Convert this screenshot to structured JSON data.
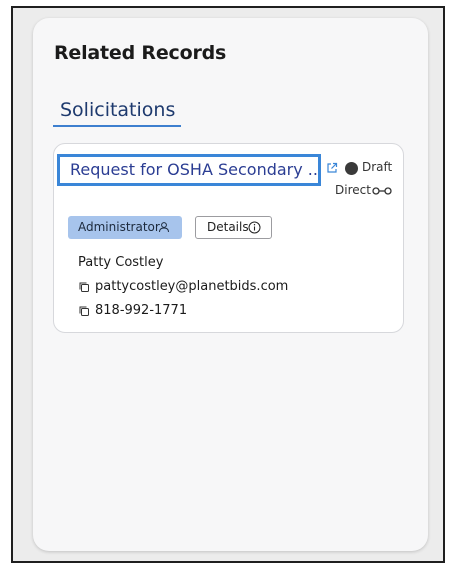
{
  "panel": {
    "title": "Related Records"
  },
  "tabs": [
    {
      "label": "Solicitations",
      "active": true
    }
  ],
  "record": {
    "title": "Request for OSHA Secondary ...",
    "status": "Draft",
    "status_color": "#3a3a3a",
    "link_type": "Direct",
    "role_badge": "Administrator",
    "details_label": "Details",
    "contact": {
      "name": "Patty Costley",
      "email": "pattycostley@planetbids.com",
      "phone": "818-992-1771"
    }
  },
  "colors": {
    "accent": "#3a86d8",
    "title_text": "#2b3d93",
    "badge_bg": "#a7c4ec",
    "tab_text": "#1e3a6e"
  },
  "icons": {
    "external_link": "external-link-icon",
    "link": "link-chain-icon",
    "user": "user-icon",
    "info": "info-icon",
    "copy": "copy-icon"
  }
}
